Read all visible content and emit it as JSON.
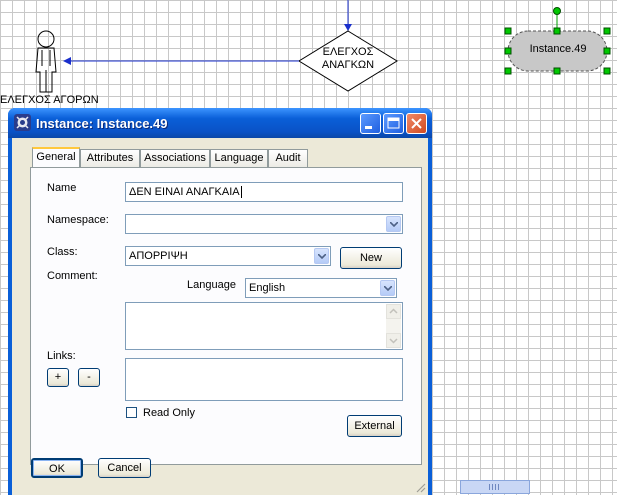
{
  "canvas": {
    "actor_label": "ΕΛΕΓΧΟΣ ΑΓΟΡΩΝ",
    "decision_text_line1": "ΕΛΕΓΧΟΣ",
    "decision_text_line2": "ΑΝΑΓΚΩΝ",
    "instance_shape_label": "Instance.49"
  },
  "dialog": {
    "title": "Instance: Instance.49",
    "tabs": [
      "General",
      "Attributes",
      "Associations",
      "Language",
      "Audit"
    ],
    "active_tab": "General",
    "fields": {
      "name_label": "Name",
      "name_value": "ΔΕΝ ΕΙΝΑΙ ΑΝΑΓΚΑΙΑ",
      "namespace_label": "Namespace:",
      "namespace_value": "",
      "class_label": "Class:",
      "class_value": "ΑΠΟΡΡΙΨΗ",
      "new_button": "New",
      "comment_label": "Comment:",
      "language_label": "Language",
      "language_value": "English",
      "comment_value": "",
      "links_label": "Links:",
      "add_link": "+",
      "remove_link": "-",
      "read_only_label": "Read Only",
      "read_only_checked": false,
      "external_button": "External"
    },
    "buttons": {
      "ok": "OK",
      "cancel": "Cancel"
    }
  },
  "colors": {
    "title_bar": "#0a5fd8",
    "dialog_face": "#ece9d8",
    "connector_blue": "#1a2fcc",
    "selection_green": "#00c800",
    "instance_fill": "#c8c8c8"
  }
}
